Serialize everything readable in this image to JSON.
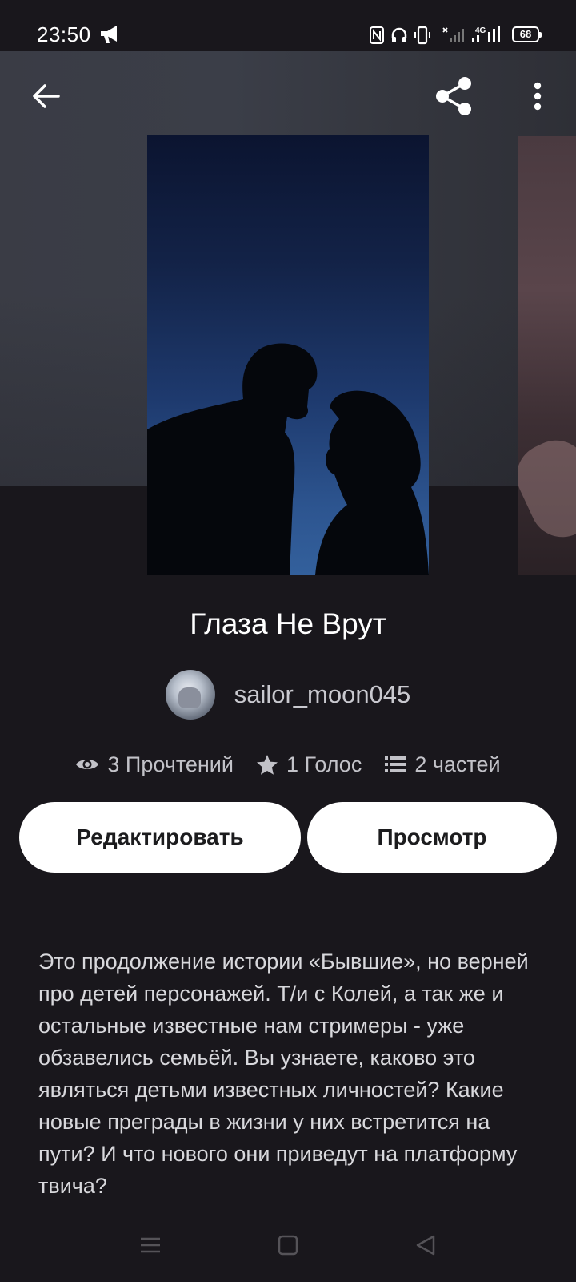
{
  "status_bar": {
    "time": "23:50",
    "battery": "68",
    "network": "4G",
    "icons": [
      "megaphone-icon",
      "nfc-icon",
      "headphones-icon",
      "vibrate-icon",
      "signal-icon",
      "battery-icon"
    ]
  },
  "header": {
    "back_icon": "arrow-left-icon",
    "share_icon": "share-icon",
    "more_icon": "more-vertical-icon"
  },
  "story": {
    "title": "Глаза Не Врут",
    "author": "sailor_moon045",
    "stats": {
      "reads": "3 Прочтений",
      "votes": "1 Голос",
      "parts": "2 частей"
    },
    "description": "Это продолжение истории «Бывшие», но верней про детей персонажей. Т/и с Колей, а так же и остальные известные нам стримеры - уже обзавелись семьёй. Вы узнаете, каково это являться детьми известных личностей? Какие новые преграды в жизни у них встретится на пути? И что нового они приведут на платформу твича?"
  },
  "actions": {
    "edit_label": "Редактировать",
    "view_label": "Просмотр"
  },
  "colors": {
    "background": "#19171c",
    "header_backdrop": "#3a3c45",
    "button_bg": "#ffffff",
    "button_text": "#1c1c1e",
    "muted_text": "#c2c2c8"
  },
  "nav_bar": {
    "icons": [
      "menu-icon",
      "home-square-icon",
      "back-triangle-icon"
    ]
  }
}
